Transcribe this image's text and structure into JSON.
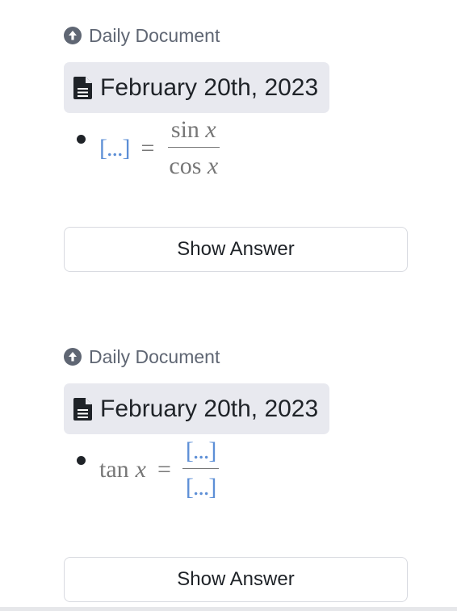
{
  "cards": [
    {
      "breadcrumb_label": "Daily Document",
      "page_title": "February 20th, 2023",
      "formula": {
        "left_cloze": "[...]",
        "equals": "=",
        "numerator_fn": "sin",
        "numerator_var": "x",
        "denominator_fn": "cos",
        "denominator_var": "x"
      },
      "button_label": "Show Answer"
    },
    {
      "breadcrumb_label": "Daily Document",
      "page_title": "February 20th, 2023",
      "formula": {
        "left_fn": "tan",
        "left_var": "x",
        "equals": "=",
        "numerator_cloze": "[...]",
        "denominator_cloze": "[...]"
      },
      "button_label": "Show Answer"
    }
  ],
  "icons": {
    "breadcrumb_icon": "arrow-up-circle-icon",
    "page_icon": "document-icon"
  },
  "colors": {
    "cloze": "#5d8fd6",
    "chip_background": "#e8e9ef",
    "breadcrumb_text": "#5f6673"
  }
}
